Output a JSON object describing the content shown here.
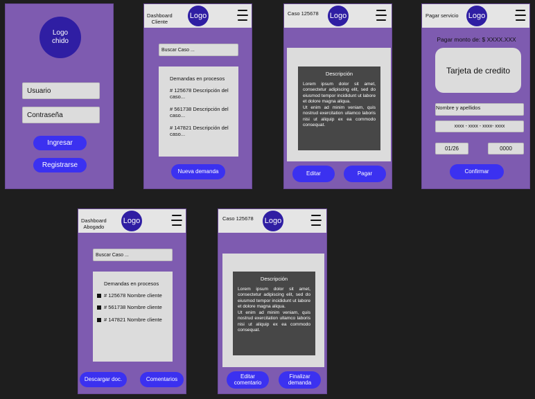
{
  "colors": {
    "frame_bg": "#7e5bb0",
    "header_bg": "#e5e5e5",
    "logo_bg": "#2f1ea3",
    "button_bg": "#3b31f0",
    "dark_card": "#474747",
    "light_panel": "#dcdcdc"
  },
  "login": {
    "logo_line1": "Logo",
    "logo_line2": "chido",
    "user_label": "Usuario",
    "password_label": "Contraseña",
    "login_button": "Ingresar",
    "register_button": "Registrarse"
  },
  "dash_cliente": {
    "title_line1": "Dashboard",
    "title_line2": "Cliente",
    "logo": "Logo",
    "search_placeholder": "Buscar Caso ...",
    "list_title": "Demandas en procesos",
    "items": [
      "# 125678 Descripción del caso...",
      "# 561738 Descripción del caso...",
      "# 147821 Descripción del caso..."
    ],
    "new_button": "Nueva demanda"
  },
  "caso_cliente": {
    "title": "Caso 125678",
    "logo": "Logo",
    "desc_title": "Descripción",
    "desc_p1": "Lorem ipsum dolor sit amet, consectetur adipiscing elit, sed do eiusmod tempor incididunt ut labore et dolore magna aliqua.",
    "desc_p2": "Ut enim ad minim veniam, quis nostrud exercitation ullamco laboris nisi ut aliquip ex ea commodo consequat.",
    "edit_button": "Editar",
    "pay_button": "Pagar"
  },
  "pagar": {
    "title": "Pagar servicio",
    "logo": "Logo",
    "amount_label": "Pagar monto de: $ XXXX.XXX",
    "card_label": "Tarjeta de credito",
    "name_field": "Nombre y apellidos",
    "card_number": "xxxx - xxxx - xxxx- xxxx",
    "expiry": "01/26",
    "cvv": "0000",
    "confirm_button": "Confirmar"
  },
  "dash_abogado": {
    "title_line1": "Dashboard",
    "title_line2": "Abogado",
    "logo": "Logo",
    "search_placeholder": "Buscar Caso ...",
    "list_title": "Demandas en procesos",
    "items": [
      "# 125678 Nombre cliente",
      "# 561738 Nombre cliente",
      "# 147821 Nombre cliente"
    ],
    "download_button": "Descargar doc.",
    "comments_button": "Comentarios"
  },
  "caso_abogado": {
    "title": "Caso 125678",
    "logo": "Logo",
    "desc_title": "Descripción",
    "desc_p1": "Lorem ipsum dolor sit amet, consectetur adipiscing elit, sed do eiusmod tempor incididunt ut labore et dolore magna aliqua.",
    "desc_p2": "Ut enim ad minim veniam, quis nostrud exercitation ullamco laboris nisi ut aliquip ex ea commodo consequat.",
    "edit_comment_button": "Editar comentario",
    "finish_button": "Finalizar demanda"
  }
}
